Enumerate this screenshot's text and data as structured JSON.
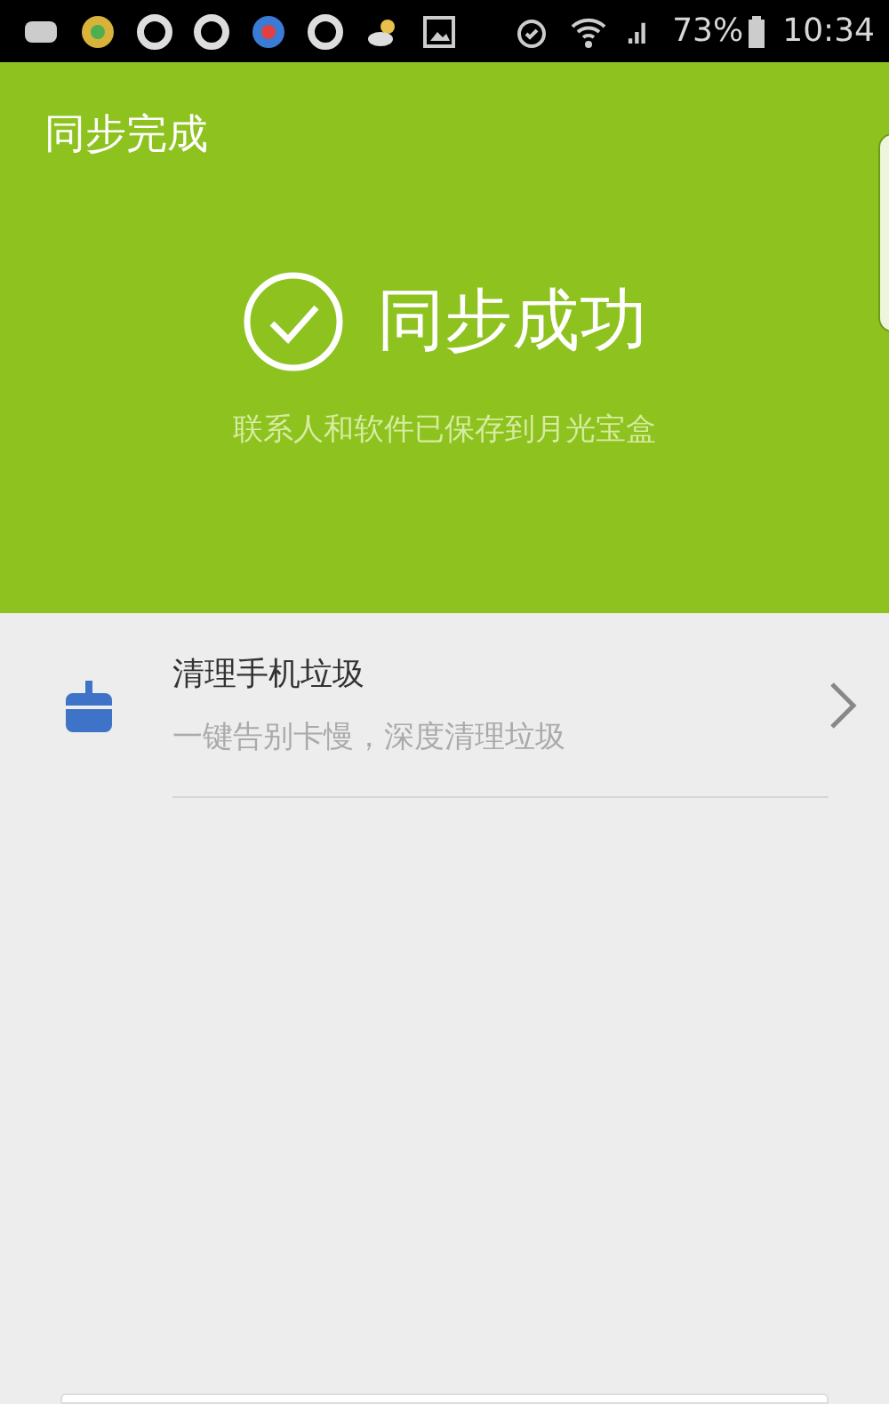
{
  "status_bar": {
    "battery_text": "73%",
    "time": "10:34"
  },
  "header": {
    "title": "同步完成",
    "result": "同步成功",
    "subtitle": "联系人和软件已保存到月光宝盒"
  },
  "list": [
    {
      "title": "清理手机垃圾",
      "subtitle": "一键告别卡慢，深度清理垃圾"
    }
  ]
}
